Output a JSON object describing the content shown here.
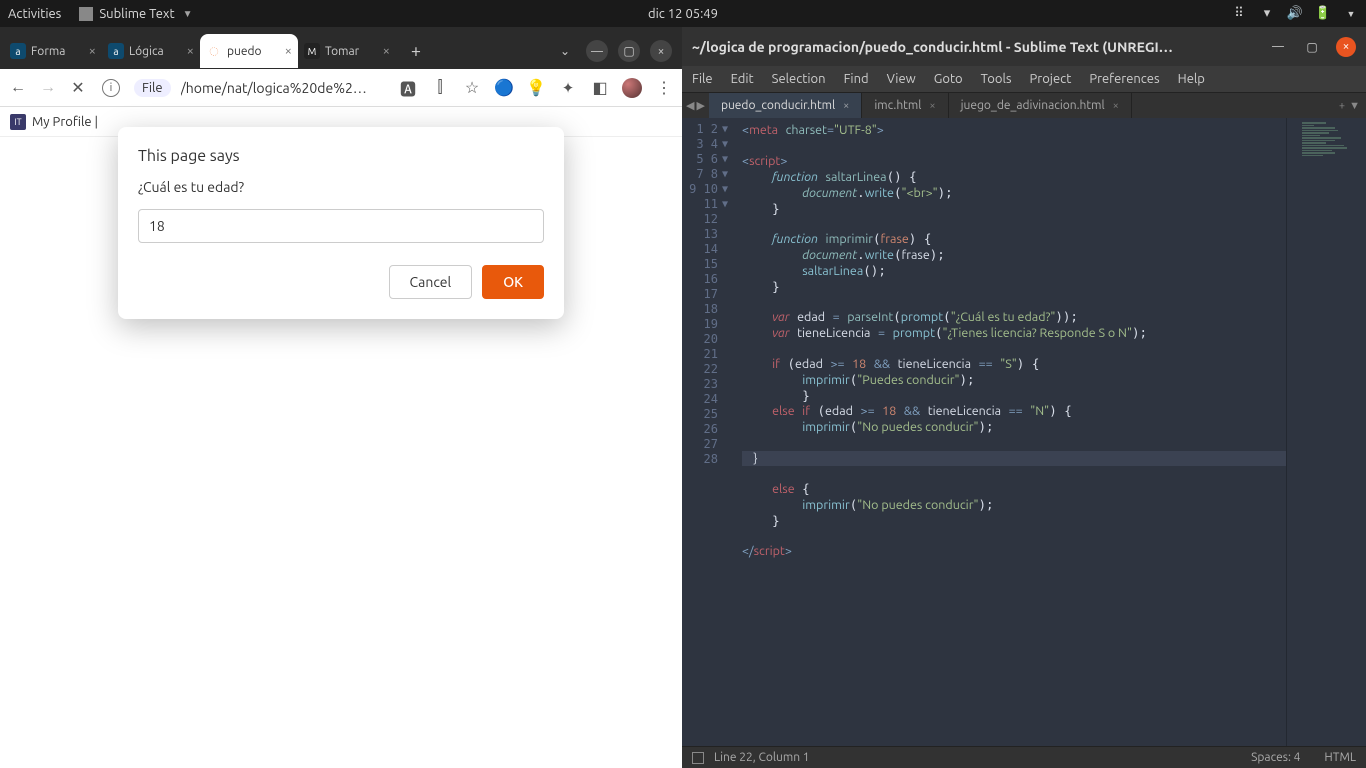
{
  "gnome": {
    "activities": "Activities",
    "app_name": "Sublime Text",
    "clock": "dic 12  05:49"
  },
  "browser": {
    "tabs": [
      {
        "favbg": "#0e4a6e",
        "favtxt": "a",
        "label": "Forma"
      },
      {
        "favbg": "#0e4a6e",
        "favtxt": "a",
        "label": "Lógica"
      },
      {
        "favbg": "#fff",
        "favtxt": "↻",
        "label": "puedo",
        "active": true
      },
      {
        "favbg": "#222",
        "favtxt": "M",
        "label": "Tomar"
      }
    ],
    "address_scheme": "File",
    "address_path": "/home/nat/logica%20de%2…",
    "bookmark": "My Profile |",
    "dialog": {
      "title": "This page says",
      "message": "¿Cuál es tu edad?",
      "value": "18",
      "cancel": "Cancel",
      "ok": "OK"
    }
  },
  "sublime": {
    "title": "~/logica de programacion/puedo_conducir.html - Sublime Text (UNREGI…",
    "menu": [
      "File",
      "Edit",
      "Selection",
      "Find",
      "View",
      "Goto",
      "Tools",
      "Project",
      "Preferences",
      "Help"
    ],
    "tabs": [
      {
        "label": "puedo_conducir.html",
        "active": true
      },
      {
        "label": "imc.html"
      },
      {
        "label": "juego_de_adivinacion.html"
      }
    ],
    "status_left": "Line 22, Column 1",
    "status_spaces": "Spaces: 4",
    "status_lang": "HTML",
    "code": {
      "l1_meta": "meta",
      "l1_charset": "charset",
      "l1_utf": "\"UTF-8\"",
      "script_open": "script",
      "script_close": "script",
      "function": "function",
      "saltar": "saltarLinea",
      "imprimir_def": "imprimir",
      "frase": "frase",
      "document": "document",
      "write": "write",
      "br": "\"<br>\"",
      "saltarCall": "saltarLinea",
      "var": "var",
      "edad": "edad",
      "parseInt": "parseInt",
      "prompt": "prompt",
      "q_edad": "\"¿Cuál es tu edad?\"",
      "tieneLic": "tieneLicencia",
      "q_lic": "\"¿Tienes licencia? Responde S o N\"",
      "if": "if",
      "else": "else",
      "eighteen": "18",
      "and": "&&",
      "eq": "==",
      "ge": ">=",
      "S": "\"S\"",
      "N": "\"N\"",
      "imprimir": "imprimir",
      "puedes": "\"Puedes conducir\"",
      "nopuedes": "\"No puedes conducir\""
    }
  }
}
